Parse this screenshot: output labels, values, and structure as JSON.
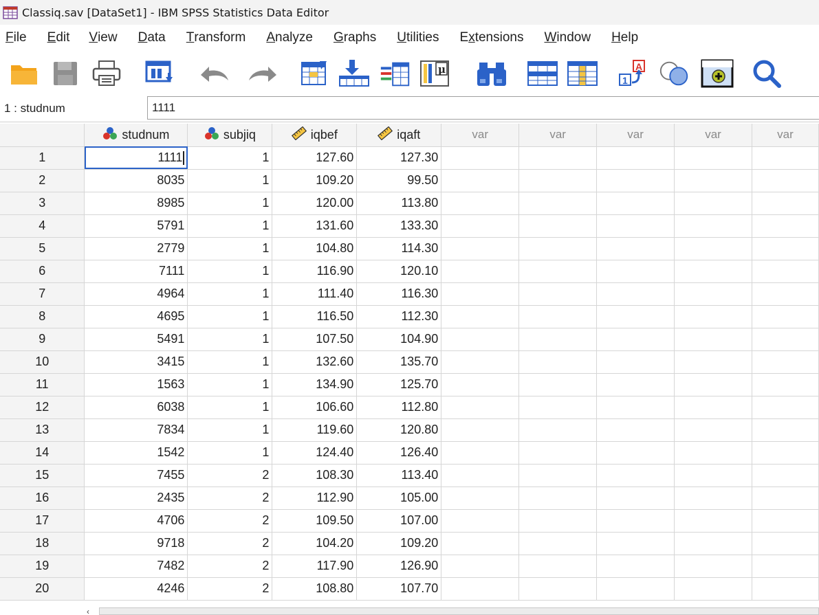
{
  "window": {
    "title": "Classiq.sav [DataSet1] - IBM SPSS Statistics Data Editor"
  },
  "menu": [
    {
      "label": "File",
      "accel": "F",
      "rest": "ile"
    },
    {
      "label": "Edit",
      "accel": "E",
      "rest": "dit"
    },
    {
      "label": "View",
      "accel": "V",
      "rest": "iew"
    },
    {
      "label": "Data",
      "accel": "D",
      "rest": "ata"
    },
    {
      "label": "Transform",
      "accel": "T",
      "rest": "ransform"
    },
    {
      "label": "Analyze",
      "accel": "A",
      "rest": "nalyze"
    },
    {
      "label": "Graphs",
      "accel": "G",
      "rest": "raphs"
    },
    {
      "label": "Utilities",
      "accel": "U",
      "rest": "tilities"
    },
    {
      "label": "Extensions",
      "pre": "E",
      "accel": "x",
      "rest": "tensions"
    },
    {
      "label": "Window",
      "accel": "W",
      "rest": "indow"
    },
    {
      "label": "Help",
      "accel": "H",
      "rest": "elp"
    }
  ],
  "toolbar": [
    {
      "icon": "open-folder-icon"
    },
    {
      "icon": "save-icon"
    },
    {
      "icon": "print-icon"
    },
    {
      "icon": "recall-dialog-icon"
    },
    {
      "icon": "undo-icon"
    },
    {
      "icon": "redo-icon"
    },
    {
      "icon": "go-to-case-icon"
    },
    {
      "icon": "go-to-variable-icon"
    },
    {
      "icon": "variables-icon"
    },
    {
      "icon": "descriptive-statistics-icon"
    },
    {
      "icon": "find-icon"
    },
    {
      "icon": "insert-cases-icon"
    },
    {
      "icon": "insert-variable-icon"
    },
    {
      "icon": "split-file-icon"
    },
    {
      "icon": "select-cases-icon"
    },
    {
      "icon": "value-labels-icon"
    },
    {
      "icon": "search-icon"
    }
  ],
  "cell_editor": {
    "reference": "1 : studnum",
    "value": "1111"
  },
  "columns": [
    {
      "name": "studnum",
      "type_icon": "nominal-icon"
    },
    {
      "name": "subjiq",
      "type_icon": "nominal-icon"
    },
    {
      "name": "iqbef",
      "type_icon": "scale-icon"
    },
    {
      "name": "iqaft",
      "type_icon": "scale-icon"
    },
    {
      "name": "var",
      "type_icon": ""
    },
    {
      "name": "var",
      "type_icon": ""
    },
    {
      "name": "var",
      "type_icon": ""
    },
    {
      "name": "var",
      "type_icon": ""
    },
    {
      "name": "var",
      "type_icon": ""
    }
  ],
  "rows": [
    {
      "n": "1",
      "studnum": "1111",
      "subjiq": "1",
      "iqbef": "127.60",
      "iqaft": "127.30"
    },
    {
      "n": "2",
      "studnum": "8035",
      "subjiq": "1",
      "iqbef": "109.20",
      "iqaft": "99.50"
    },
    {
      "n": "3",
      "studnum": "8985",
      "subjiq": "1",
      "iqbef": "120.00",
      "iqaft": "113.80"
    },
    {
      "n": "4",
      "studnum": "5791",
      "subjiq": "1",
      "iqbef": "131.60",
      "iqaft": "133.30"
    },
    {
      "n": "5",
      "studnum": "2779",
      "subjiq": "1",
      "iqbef": "104.80",
      "iqaft": "114.30"
    },
    {
      "n": "6",
      "studnum": "7111",
      "subjiq": "1",
      "iqbef": "116.90",
      "iqaft": "120.10"
    },
    {
      "n": "7",
      "studnum": "4964",
      "subjiq": "1",
      "iqbef": "111.40",
      "iqaft": "116.30"
    },
    {
      "n": "8",
      "studnum": "4695",
      "subjiq": "1",
      "iqbef": "116.50",
      "iqaft": "112.30"
    },
    {
      "n": "9",
      "studnum": "5491",
      "subjiq": "1",
      "iqbef": "107.50",
      "iqaft": "104.90"
    },
    {
      "n": "10",
      "studnum": "3415",
      "subjiq": "1",
      "iqbef": "132.60",
      "iqaft": "135.70"
    },
    {
      "n": "11",
      "studnum": "1563",
      "subjiq": "1",
      "iqbef": "134.90",
      "iqaft": "125.70"
    },
    {
      "n": "12",
      "studnum": "6038",
      "subjiq": "1",
      "iqbef": "106.60",
      "iqaft": "112.80"
    },
    {
      "n": "13",
      "studnum": "7834",
      "subjiq": "1",
      "iqbef": "119.60",
      "iqaft": "120.80"
    },
    {
      "n": "14",
      "studnum": "1542",
      "subjiq": "1",
      "iqbef": "124.40",
      "iqaft": "126.40"
    },
    {
      "n": "15",
      "studnum": "7455",
      "subjiq": "2",
      "iqbef": "108.30",
      "iqaft": "113.40"
    },
    {
      "n": "16",
      "studnum": "2435",
      "subjiq": "2",
      "iqbef": "112.90",
      "iqaft": "105.00"
    },
    {
      "n": "17",
      "studnum": "4706",
      "subjiq": "2",
      "iqbef": "109.50",
      "iqaft": "107.00"
    },
    {
      "n": "18",
      "studnum": "9718",
      "subjiq": "2",
      "iqbef": "104.20",
      "iqaft": "109.20"
    },
    {
      "n": "19",
      "studnum": "7482",
      "subjiq": "2",
      "iqbef": "117.90",
      "iqaft": "126.90"
    },
    {
      "n": "20",
      "studnum": "4246",
      "subjiq": "2",
      "iqbef": "108.80",
      "iqaft": "107.70"
    }
  ],
  "selected_cell": {
    "row": "1",
    "column": "studnum"
  },
  "colors": {
    "accent_blue": "#2b62c8",
    "grid_line": "#d6d6d6",
    "header_bg": "#f4f4f4"
  }
}
